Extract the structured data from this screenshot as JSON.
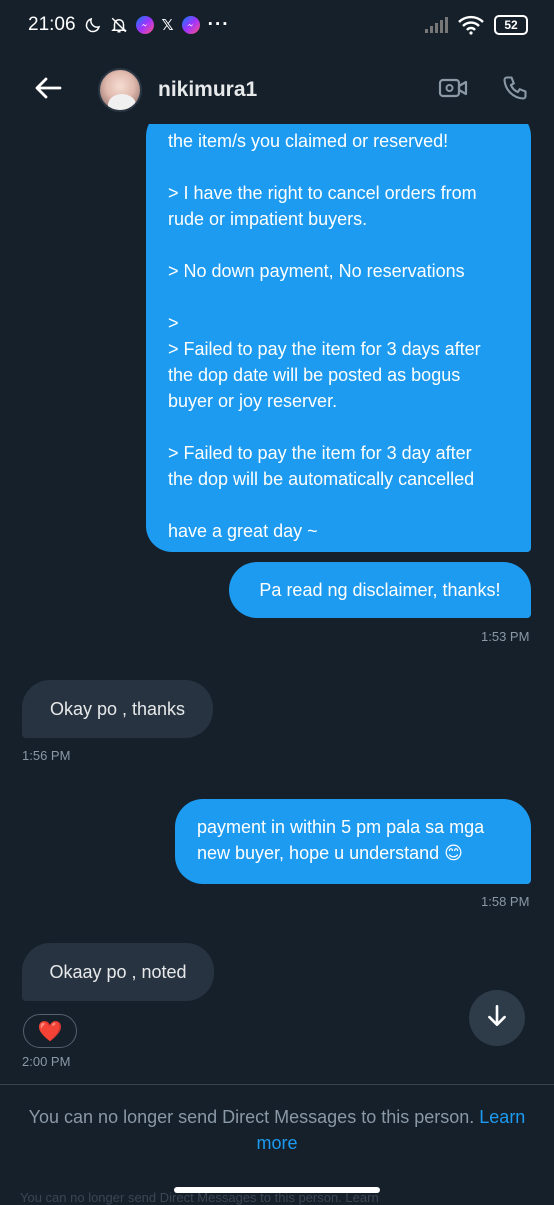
{
  "status_bar": {
    "time": "21:06",
    "battery": "52",
    "notification_icons": [
      "moon-icon",
      "mute-bell-icon",
      "messenger-icon",
      "x-icon",
      "messenger-icon",
      "more-dots-icon"
    ],
    "x_glyph": "𝕏",
    "dots": "···"
  },
  "header": {
    "username": "nikimura1",
    "icons": [
      "back-arrow-icon",
      "video-call-icon",
      "phone-call-icon"
    ]
  },
  "messages": {
    "big": {
      "lines": [
        "the item/s you claimed or reserved!",
        "",
        "> I have the right to cancel orders from",
        "rude or impatient buyers.",
        "",
        "> No down payment, No reservations",
        "",
        ">",
        "> Failed to pay the item for 3 days after",
        "the dop date will be posted as bogus",
        "buyer or joy reserver.",
        "",
        "> Failed to pay the item for 3 day after",
        "the dop will be automatically cancelled",
        "",
        "have a great day ~"
      ]
    },
    "pa": {
      "text": "Pa read ng disclaimer, thanks!",
      "time": "1:53 PM"
    },
    "okay1": {
      "text": "Okay po , thanks",
      "time": "1:56 PM"
    },
    "payment": {
      "lines": [
        "payment in within 5 pm pala sa mga",
        "new buyer, hope u understand 😊"
      ],
      "time": "1:58 PM"
    },
    "okay2": {
      "text": "Okaay po , noted",
      "time": "2:00 PM",
      "reaction": "❤️"
    }
  },
  "footer": {
    "note": "You can no longer send Direct Messages to this person.",
    "link": "Learn more",
    "ghost": "You can no longer send Direct Messages to this person. Learn"
  },
  "colors": {
    "background": "#15202b",
    "outgoing_bubble": "#1d9bf0",
    "incoming_bubble": "#273340",
    "link": "#1d9bf0",
    "muted_text": "#8b98a5"
  }
}
